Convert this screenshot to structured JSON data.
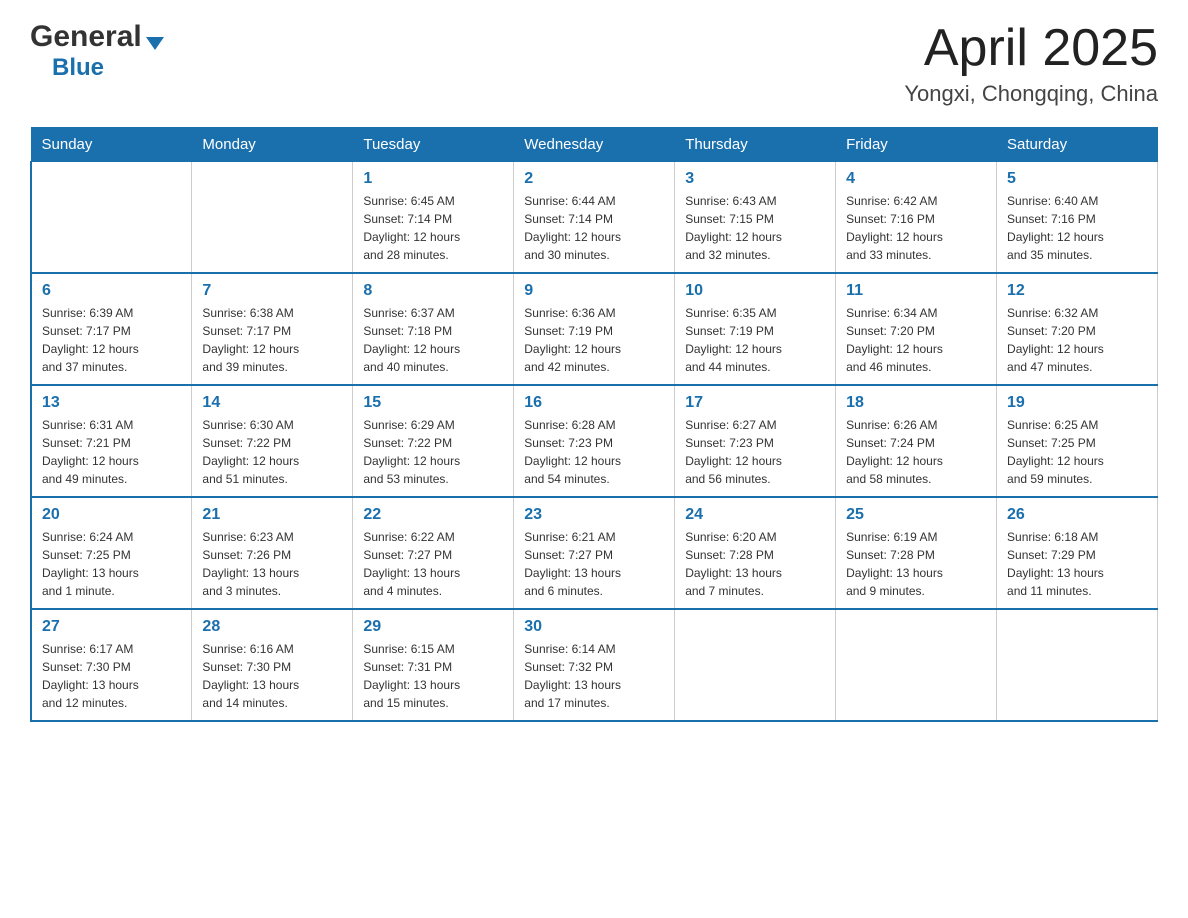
{
  "header": {
    "logo_general": "General",
    "logo_blue": "Blue",
    "month_year": "April 2025",
    "location": "Yongxi, Chongqing, China"
  },
  "columns": [
    "Sunday",
    "Monday",
    "Tuesday",
    "Wednesday",
    "Thursday",
    "Friday",
    "Saturday"
  ],
  "weeks": [
    [
      {
        "day": "",
        "info": ""
      },
      {
        "day": "",
        "info": ""
      },
      {
        "day": "1",
        "info": "Sunrise: 6:45 AM\nSunset: 7:14 PM\nDaylight: 12 hours\nand 28 minutes."
      },
      {
        "day": "2",
        "info": "Sunrise: 6:44 AM\nSunset: 7:14 PM\nDaylight: 12 hours\nand 30 minutes."
      },
      {
        "day": "3",
        "info": "Sunrise: 6:43 AM\nSunset: 7:15 PM\nDaylight: 12 hours\nand 32 minutes."
      },
      {
        "day": "4",
        "info": "Sunrise: 6:42 AM\nSunset: 7:16 PM\nDaylight: 12 hours\nand 33 minutes."
      },
      {
        "day": "5",
        "info": "Sunrise: 6:40 AM\nSunset: 7:16 PM\nDaylight: 12 hours\nand 35 minutes."
      }
    ],
    [
      {
        "day": "6",
        "info": "Sunrise: 6:39 AM\nSunset: 7:17 PM\nDaylight: 12 hours\nand 37 minutes."
      },
      {
        "day": "7",
        "info": "Sunrise: 6:38 AM\nSunset: 7:17 PM\nDaylight: 12 hours\nand 39 minutes."
      },
      {
        "day": "8",
        "info": "Sunrise: 6:37 AM\nSunset: 7:18 PM\nDaylight: 12 hours\nand 40 minutes."
      },
      {
        "day": "9",
        "info": "Sunrise: 6:36 AM\nSunset: 7:19 PM\nDaylight: 12 hours\nand 42 minutes."
      },
      {
        "day": "10",
        "info": "Sunrise: 6:35 AM\nSunset: 7:19 PM\nDaylight: 12 hours\nand 44 minutes."
      },
      {
        "day": "11",
        "info": "Sunrise: 6:34 AM\nSunset: 7:20 PM\nDaylight: 12 hours\nand 46 minutes."
      },
      {
        "day": "12",
        "info": "Sunrise: 6:32 AM\nSunset: 7:20 PM\nDaylight: 12 hours\nand 47 minutes."
      }
    ],
    [
      {
        "day": "13",
        "info": "Sunrise: 6:31 AM\nSunset: 7:21 PM\nDaylight: 12 hours\nand 49 minutes."
      },
      {
        "day": "14",
        "info": "Sunrise: 6:30 AM\nSunset: 7:22 PM\nDaylight: 12 hours\nand 51 minutes."
      },
      {
        "day": "15",
        "info": "Sunrise: 6:29 AM\nSunset: 7:22 PM\nDaylight: 12 hours\nand 53 minutes."
      },
      {
        "day": "16",
        "info": "Sunrise: 6:28 AM\nSunset: 7:23 PM\nDaylight: 12 hours\nand 54 minutes."
      },
      {
        "day": "17",
        "info": "Sunrise: 6:27 AM\nSunset: 7:23 PM\nDaylight: 12 hours\nand 56 minutes."
      },
      {
        "day": "18",
        "info": "Sunrise: 6:26 AM\nSunset: 7:24 PM\nDaylight: 12 hours\nand 58 minutes."
      },
      {
        "day": "19",
        "info": "Sunrise: 6:25 AM\nSunset: 7:25 PM\nDaylight: 12 hours\nand 59 minutes."
      }
    ],
    [
      {
        "day": "20",
        "info": "Sunrise: 6:24 AM\nSunset: 7:25 PM\nDaylight: 13 hours\nand 1 minute."
      },
      {
        "day": "21",
        "info": "Sunrise: 6:23 AM\nSunset: 7:26 PM\nDaylight: 13 hours\nand 3 minutes."
      },
      {
        "day": "22",
        "info": "Sunrise: 6:22 AM\nSunset: 7:27 PM\nDaylight: 13 hours\nand 4 minutes."
      },
      {
        "day": "23",
        "info": "Sunrise: 6:21 AM\nSunset: 7:27 PM\nDaylight: 13 hours\nand 6 minutes."
      },
      {
        "day": "24",
        "info": "Sunrise: 6:20 AM\nSunset: 7:28 PM\nDaylight: 13 hours\nand 7 minutes."
      },
      {
        "day": "25",
        "info": "Sunrise: 6:19 AM\nSunset: 7:28 PM\nDaylight: 13 hours\nand 9 minutes."
      },
      {
        "day": "26",
        "info": "Sunrise: 6:18 AM\nSunset: 7:29 PM\nDaylight: 13 hours\nand 11 minutes."
      }
    ],
    [
      {
        "day": "27",
        "info": "Sunrise: 6:17 AM\nSunset: 7:30 PM\nDaylight: 13 hours\nand 12 minutes."
      },
      {
        "day": "28",
        "info": "Sunrise: 6:16 AM\nSunset: 7:30 PM\nDaylight: 13 hours\nand 14 minutes."
      },
      {
        "day": "29",
        "info": "Sunrise: 6:15 AM\nSunset: 7:31 PM\nDaylight: 13 hours\nand 15 minutes."
      },
      {
        "day": "30",
        "info": "Sunrise: 6:14 AM\nSunset: 7:32 PM\nDaylight: 13 hours\nand 17 minutes."
      },
      {
        "day": "",
        "info": ""
      },
      {
        "day": "",
        "info": ""
      },
      {
        "day": "",
        "info": ""
      }
    ]
  ]
}
